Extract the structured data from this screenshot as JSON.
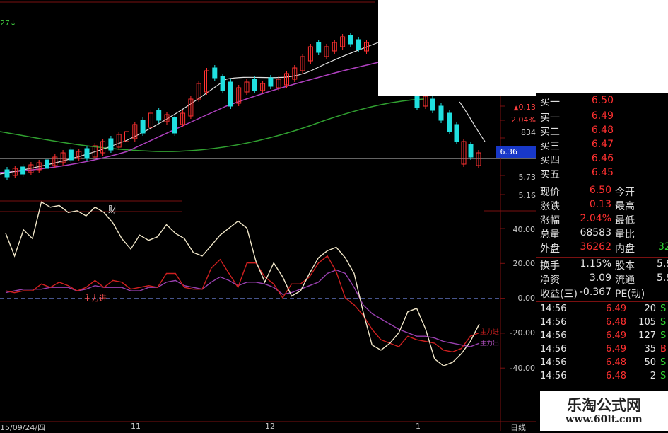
{
  "colors": {
    "up": "#ff3030",
    "down": "#20e0e0",
    "ma_white": "#e0e0e0",
    "ma_violet": "#b040c0",
    "ma_green": "#30a030",
    "grid_red": "#7a1010",
    "indicator_white": "#f0e6c8",
    "indicator_red": "#d02020",
    "indicator_violet": "#9a40b0"
  },
  "top_left_label": "27↓",
  "upper_chart": {
    "y_labels": [
      "0.13",
      "2.04%",
      "834",
      "6.36",
      "5.73",
      "5.16"
    ],
    "highlight_price": "6.36",
    "arrow_glyph": "▲",
    "section_label": "财"
  },
  "indicator": {
    "y_labels": [
      "40.00",
      "20.00",
      "0.00",
      "-20.00",
      "-40.00"
    ],
    "annotation": "主力进",
    "right_labels": [
      "主力进",
      "主力出"
    ],
    "white": [
      37,
      24,
      39,
      34,
      55,
      52,
      53,
      49,
      50,
      47,
      52,
      49,
      43,
      34,
      28,
      36,
      33,
      35,
      42,
      37,
      34,
      26,
      24,
      30,
      36,
      40,
      44,
      40,
      21,
      9,
      20,
      12,
      1,
      4,
      14,
      23,
      27,
      29,
      23,
      14,
      -8,
      -27,
      -30,
      -26,
      -20,
      -8,
      -6,
      -18,
      -35,
      -39,
      -37,
      -32,
      -25,
      -15
    ],
    "red": [
      4,
      3,
      4,
      4,
      8,
      6,
      9,
      7,
      4,
      6,
      10,
      6,
      10,
      9,
      5,
      6,
      7,
      6,
      14,
      14,
      6,
      5,
      5,
      17,
      22,
      14,
      6,
      20,
      20,
      12,
      8,
      0,
      8,
      8,
      12,
      20,
      24,
      15,
      0,
      -4,
      -10,
      -18,
      -24,
      -26,
      -28,
      -22,
      -24,
      -25,
      -26,
      -30,
      -31,
      -29,
      -22,
      -20
    ],
    "violet": [
      3,
      4,
      5,
      5,
      5,
      6,
      6,
      6,
      4,
      5,
      7,
      6,
      6,
      6,
      4,
      4,
      6,
      6,
      9,
      10,
      7,
      6,
      5,
      9,
      12,
      10,
      7,
      9,
      9,
      8,
      6,
      2,
      3,
      5,
      7,
      9,
      14,
      16,
      14,
      6,
      -4,
      -9,
      -12,
      -15,
      -18,
      -20,
      -22,
      -22,
      -23,
      -25,
      -26,
      -27,
      -28,
      -26
    ]
  },
  "x_labels": [
    "15/09/24/四",
    "11",
    "12",
    "1",
    "日线"
  ],
  "quote_panel": {
    "buy_rows": [
      {
        "label": "买一",
        "value": "6.50"
      },
      {
        "label": "买一",
        "value": "6.49"
      },
      {
        "label": "买二",
        "value": "6.48"
      },
      {
        "label": "买三",
        "value": "6.47"
      },
      {
        "label": "买四",
        "value": "6.46"
      },
      {
        "label": "买五",
        "value": "6.45"
      }
    ],
    "stats": [
      {
        "label": "现价",
        "value": "6.50",
        "label2": "今开",
        "value2": ""
      },
      {
        "label": "涨跌",
        "value": "0.13",
        "label2": "最高",
        "value2": ""
      },
      {
        "label": "涨幅",
        "value": "2.04%",
        "label2": "最低",
        "value2": ""
      },
      {
        "label": "总量",
        "value": "68583",
        "label2": "量比",
        "value2": ""
      },
      {
        "label": "外盘",
        "value": "36262",
        "label2": "内盘",
        "value2": "32"
      }
    ],
    "stats2": [
      {
        "label": "换手",
        "value": "1.15%",
        "label2": "股本",
        "value2": "5.9"
      },
      {
        "label": "净资",
        "value": "3.09",
        "label2": "流通",
        "value2": "5.9"
      },
      {
        "label": "收益(三)",
        "value": "-0.367",
        "label2": "PE(动)",
        "value2": ""
      }
    ],
    "ticks": [
      {
        "time": "14:56",
        "price": "6.49",
        "vol": "20",
        "dir": "S"
      },
      {
        "time": "14:56",
        "price": "6.48",
        "vol": "105",
        "dir": "S"
      },
      {
        "time": "14:56",
        "price": "6.49",
        "vol": "127",
        "dir": "S"
      },
      {
        "time": "14:56",
        "price": "6.49",
        "vol": "35",
        "dir": "B"
      },
      {
        "time": "14:56",
        "price": "6.48",
        "vol": "50",
        "dir": "S"
      },
      {
        "time": "14:56",
        "price": "6.48",
        "vol": "2",
        "dir": "S"
      }
    ]
  },
  "watermark": {
    "title": "乐淘公式网",
    "url": "www.60lt.com"
  }
}
